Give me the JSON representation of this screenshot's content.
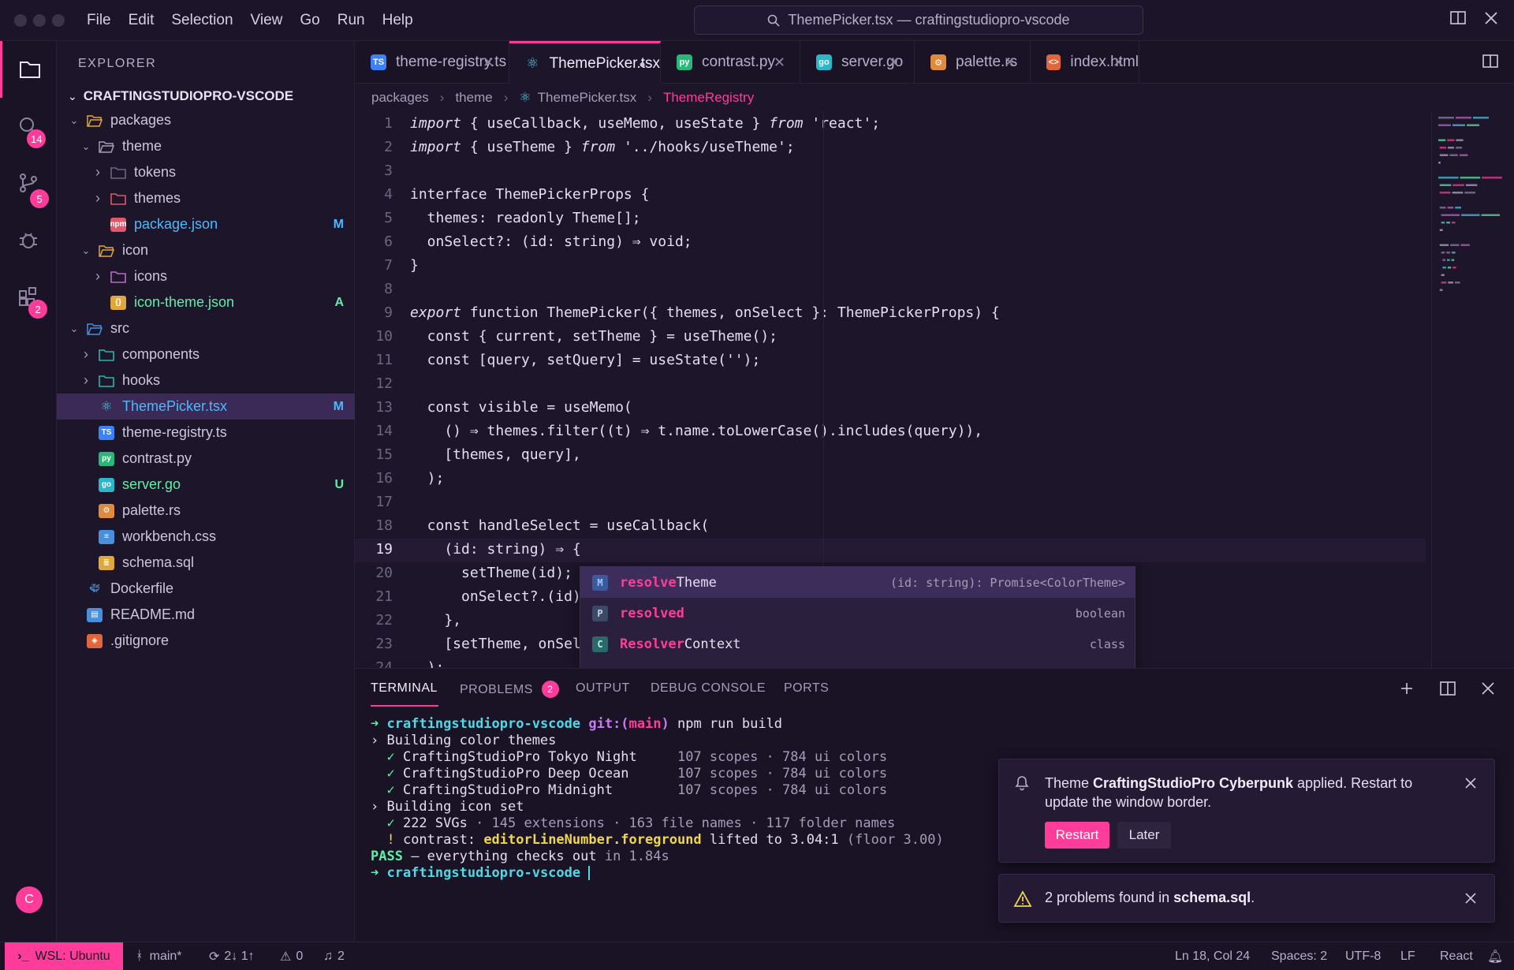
{
  "titlebar": {
    "menu": [
      "File",
      "Edit",
      "Selection",
      "View",
      "Go",
      "Run",
      "Help"
    ],
    "command_center": "ThemePicker.tsx — craftingstudiopro-vscode"
  },
  "activity": {
    "search_badge": "14",
    "scm_badge": "5",
    "extensions_badge": "2",
    "avatar": "C"
  },
  "sidebar": {
    "header": "EXPLORER",
    "project": "CRAFTINGSTUDIOPRO-VSCODE",
    "rows": [
      {
        "label": "packages",
        "indent": 0,
        "chev": "open",
        "icon": "folder-open",
        "color": "#e0a83b",
        "labelColor": "#cfc6dd",
        "status": ""
      },
      {
        "label": "theme",
        "indent": 1,
        "chev": "open",
        "icon": "folder-open",
        "color": "#a69cb8",
        "labelColor": "#cfc6dd",
        "status": ""
      },
      {
        "label": "tokens",
        "indent": 2,
        "chev": "closed",
        "icon": "folder",
        "color": "#6f6582",
        "labelColor": "#cfc6dd",
        "status": ""
      },
      {
        "label": "themes",
        "indent": 2,
        "chev": "closed",
        "icon": "folder",
        "color": "#e0566b",
        "labelColor": "#cfc6dd",
        "status": ""
      },
      {
        "label": "package.json",
        "indent": 2,
        "chev": "none",
        "icon": "npm",
        "color": "#e0566b",
        "labelColor": "#4db8ff",
        "status": "M",
        "statusColor": "#4db8ff"
      },
      {
        "label": "icon",
        "indent": 1,
        "chev": "open",
        "icon": "folder-open",
        "color": "#e0a83b",
        "labelColor": "#cfc6dd",
        "status": ""
      },
      {
        "label": "icons",
        "indent": 2,
        "chev": "closed",
        "icon": "folder",
        "color": "#c067c9",
        "labelColor": "#cfc6dd",
        "status": ""
      },
      {
        "label": "icon-theme.json",
        "indent": 2,
        "chev": "none",
        "icon": "json",
        "color": "#e0a83b",
        "labelColor": "#5ef0a8",
        "status": "A",
        "statusColor": "#5ef0a8"
      },
      {
        "label": "src",
        "indent": 0,
        "chev": "open",
        "icon": "folder-open",
        "color": "#4a8fd9",
        "labelColor": "#cfc6dd",
        "status": ""
      },
      {
        "label": "components",
        "indent": 1,
        "chev": "closed",
        "icon": "folder",
        "color": "#2ab7a9",
        "labelColor": "#cfc6dd",
        "status": ""
      },
      {
        "label": "hooks",
        "indent": 1,
        "chev": "closed",
        "icon": "folder",
        "color": "#2ab7a9",
        "labelColor": "#cfc6dd",
        "status": ""
      },
      {
        "label": "ThemePicker.tsx",
        "indent": 1,
        "chev": "none",
        "icon": "react",
        "color": "#4dc9e6",
        "labelColor": "#4db8ff",
        "status": "M",
        "statusColor": "#4db8ff",
        "selected": true
      },
      {
        "label": "theme-registry.ts",
        "indent": 1,
        "chev": "none",
        "icon": "ts",
        "color": "#3b82f6",
        "labelColor": "#cfc6dd",
        "status": ""
      },
      {
        "label": "contrast.py",
        "indent": 1,
        "chev": "none",
        "icon": "py",
        "color": "#2ab77a",
        "labelColor": "#cfc6dd",
        "status": ""
      },
      {
        "label": "server.go",
        "indent": 1,
        "chev": "none",
        "icon": "go",
        "color": "#2ab7c9",
        "labelColor": "#5ef0a8",
        "status": "U",
        "statusColor": "#5ef0a8"
      },
      {
        "label": "palette.rs",
        "indent": 1,
        "chev": "none",
        "icon": "rs",
        "color": "#e08a3b",
        "labelColor": "#cfc6dd",
        "status": ""
      },
      {
        "label": "workbench.css",
        "indent": 1,
        "chev": "none",
        "icon": "css",
        "color": "#4a8fd9",
        "labelColor": "#cfc6dd",
        "status": ""
      },
      {
        "label": "schema.sql",
        "indent": 1,
        "chev": "none",
        "icon": "sql",
        "color": "#e0a83b",
        "labelColor": "#cfc6dd",
        "status": ""
      },
      {
        "label": "Dockerfile",
        "indent": 0,
        "chev": "none",
        "icon": "docker",
        "color": "#4a8fd9",
        "labelColor": "#cfc6dd",
        "status": ""
      },
      {
        "label": "README.md",
        "indent": 0,
        "chev": "none",
        "icon": "md",
        "color": "#4a8fd9",
        "labelColor": "#cfc6dd",
        "status": ""
      },
      {
        "label": ".gitignore",
        "indent": 0,
        "chev": "none",
        "icon": "git",
        "color": "#e0663b",
        "labelColor": "#cfc6dd",
        "status": ""
      }
    ]
  },
  "tabs": [
    {
      "label": "theme-registry.ts",
      "icon": "TS",
      "color": "#3b82f6",
      "active": false,
      "dirty": false
    },
    {
      "label": "ThemePicker.tsx",
      "icon": "⚛",
      "color": "#1d1529",
      "iconColor": "#4dc9e6",
      "active": true,
      "dirty": true
    },
    {
      "label": "contrast.py",
      "icon": "py",
      "color": "#2ab77a",
      "active": false,
      "dirty": false
    },
    {
      "label": "server.go",
      "icon": "go",
      "color": "#2ab7c9",
      "active": false,
      "dirty": false
    },
    {
      "label": "palette.rs",
      "icon": "⚙",
      "color": "#e08a3b",
      "active": false,
      "dirty": false
    },
    {
      "label": "index.html",
      "icon": "<>",
      "color": "#e0663b",
      "active": false,
      "dirty": false
    }
  ],
  "breadcrumb": [
    "packages",
    "theme",
    "ThemePicker.tsx",
    "ThemeRegistry"
  ],
  "editor": {
    "current_line": 19,
    "lines": [
      [
        {
          "t": "import",
          "c": "#e6def0",
          "i": true
        },
        {
          "t": " { useCallback, useMemo, useState } ",
          "c": "#e6def0"
        },
        {
          "t": "from",
          "c": "#e6def0",
          "i": true
        },
        {
          "t": " 'react';",
          "c": "#e6def0"
        }
      ],
      [
        {
          "t": "import",
          "c": "#e6def0",
          "i": true
        },
        {
          "t": " { useTheme } ",
          "c": "#e6def0"
        },
        {
          "t": "from",
          "c": "#e6def0",
          "i": true
        },
        {
          "t": " '../hooks/useTheme';",
          "c": "#e6def0"
        }
      ],
      [],
      [
        {
          "t": "interface ThemePickerProps {",
          "c": "#e6def0"
        }
      ],
      [
        {
          "t": "  themes: readonly Theme[];",
          "c": "#e6def0"
        }
      ],
      [
        {
          "t": "  onSelect?: (id: string) ⇒ void;",
          "c": "#e6def0"
        }
      ],
      [
        {
          "t": "}",
          "c": "#e6def0"
        }
      ],
      [],
      [
        {
          "t": "export",
          "c": "#e6def0",
          "i": true
        },
        {
          "t": " function ThemePicker({ themes, onSelect }: ThemePickerProps) {",
          "c": "#e6def0"
        }
      ],
      [
        {
          "t": "  const { current, setTheme } = useTheme();",
          "c": "#e6def0"
        }
      ],
      [
        {
          "t": "  const [query, setQuery] = useState('');",
          "c": "#e6def0"
        }
      ],
      [],
      [
        {
          "t": "  const visible = useMemo(",
          "c": "#e6def0"
        }
      ],
      [
        {
          "t": "    () ⇒ themes.filter((t) ⇒ t.name.toLowerCase().includes(query)),",
          "c": "#e6def0"
        }
      ],
      [
        {
          "t": "    [themes, query],",
          "c": "#e6def0"
        }
      ],
      [
        {
          "t": "  );",
          "c": "#e6def0"
        }
      ],
      [],
      [
        {
          "t": "  const handleSelect = useCallback(",
          "c": "#e6def0"
        }
      ],
      [
        {
          "t": "    (id: string) ⇒ {",
          "c": "#e6def0"
        }
      ],
      [
        {
          "t": "      setTheme(id);",
          "c": "#e6def0"
        }
      ],
      [
        {
          "t": "      onSelect?.(id);",
          "c": "#e6def0"
        }
      ],
      [
        {
          "t": "    },",
          "c": "#e6def0"
        }
      ],
      [
        {
          "t": "    [setTheme, onSelect],",
          "c": "#e6def0"
        }
      ],
      [
        {
          "t": "  );",
          "c": "#e6def0"
        }
      ]
    ]
  },
  "suggest": [
    {
      "kind": "M",
      "kindBg": "#3b5a9e",
      "kindColor": "#9ec7ff",
      "match": "resolve",
      "rest": "Theme",
      "detail": "(id: string): Promise<ColorTheme>",
      "selected": true
    },
    {
      "kind": "P",
      "kindBg": "#3d4a66",
      "kindColor": "#c3d2ee",
      "match": "resolved",
      "rest": "",
      "detail": "boolean",
      "selected": false
    },
    {
      "kind": "C",
      "kindBg": "#2a6a6a",
      "kindColor": "#b7f0ea",
      "match": "Resolver",
      "rest": "Context",
      "detail": "class",
      "selected": false
    }
  ],
  "panel": {
    "tabs": [
      "TERMINAL",
      "PROBLEMS",
      "OUTPUT",
      "DEBUG CONSOLE",
      "PORTS"
    ],
    "problems_badge": "2",
    "terminal": [
      [
        {
          "t": "➜ ",
          "c": "#5ef0a8",
          "b": true
        },
        {
          "t": "craftingstudiopro-vscode ",
          "c": "#4dd9e6",
          "b": true
        },
        {
          "t": "git:(",
          "c": "#c67cf0",
          "b": true
        },
        {
          "t": "main",
          "c": "#ff3c9a",
          "b": true
        },
        {
          "t": ")",
          "c": "#c67cf0",
          "b": true
        },
        {
          "t": " npm run build",
          "c": "#e6def0"
        }
      ],
      [
        {
          "t": "› Building color themes",
          "c": "#e6def0"
        }
      ],
      [
        {
          "t": "  ✓ ",
          "c": "#5ef0a8"
        },
        {
          "t": "CraftingStudioPro Tokyo Night     ",
          "c": "#e6def0"
        },
        {
          "t": "107 scopes · 784 ui colors",
          "c": "#a69cb8"
        }
      ],
      [
        {
          "t": "  ✓ ",
          "c": "#5ef0a8"
        },
        {
          "t": "CraftingStudioPro Deep Ocean      ",
          "c": "#e6def0"
        },
        {
          "t": "107 scopes · 784 ui colors",
          "c": "#a69cb8"
        }
      ],
      [
        {
          "t": "  ✓ ",
          "c": "#5ef0a8"
        },
        {
          "t": "CraftingStudioPro Midnight        ",
          "c": "#e6def0"
        },
        {
          "t": "107 scopes · 784 ui colors",
          "c": "#a69cb8"
        }
      ],
      [
        {
          "t": "› Building icon set",
          "c": "#e6def0"
        }
      ],
      [
        {
          "t": "  ✓ ",
          "c": "#5ef0a8"
        },
        {
          "t": "222 SVGs ",
          "c": "#e6def0"
        },
        {
          "t": "· 145 extensions · 163 file names · 117 folder names",
          "c": "#a69cb8"
        }
      ],
      [
        {
          "t": "  ! ",
          "c": "#f0d64a"
        },
        {
          "t": "contrast: ",
          "c": "#e6def0"
        },
        {
          "t": "editorLineNumber.foreground",
          "c": "#f0d64a",
          "b": true
        },
        {
          "t": " lifted to 3.04:1 ",
          "c": "#e6def0"
        },
        {
          "t": "(floor 3.00)",
          "c": "#a69cb8"
        }
      ],
      [
        {
          "t": "PASS",
          "c": "#5ef0a8",
          "b": true
        },
        {
          "t": " — everything checks out ",
          "c": "#e6def0"
        },
        {
          "t": "in 1.84s",
          "c": "#a69cb8"
        }
      ],
      [
        {
          "t": "➜ ",
          "c": "#5ef0a8",
          "b": true
        },
        {
          "t": "craftingstudiopro-vscode ",
          "c": "#4dd9e6",
          "b": true
        }
      ]
    ]
  },
  "notifications": {
    "theme": {
      "pre": "Theme ",
      "bold": "CraftingStudioPro Cyberpunk",
      "post": " applied. Restart to update the window border.",
      "primary": "Restart",
      "secondary": "Later"
    },
    "problems": {
      "pre": "2 problems found in ",
      "bold": "schema.sql",
      "post": "."
    }
  },
  "status": {
    "remote": "WSL: Ubuntu",
    "branch": "main*",
    "sync": "2↓ 1↑",
    "warnings": "0",
    "bell": "2",
    "position": "Ln 18, Col 24",
    "spaces": "Spaces: 2",
    "encoding": "UTF-8",
    "eol": "LF",
    "language": "React",
    "accent": "#ff3c9a"
  }
}
